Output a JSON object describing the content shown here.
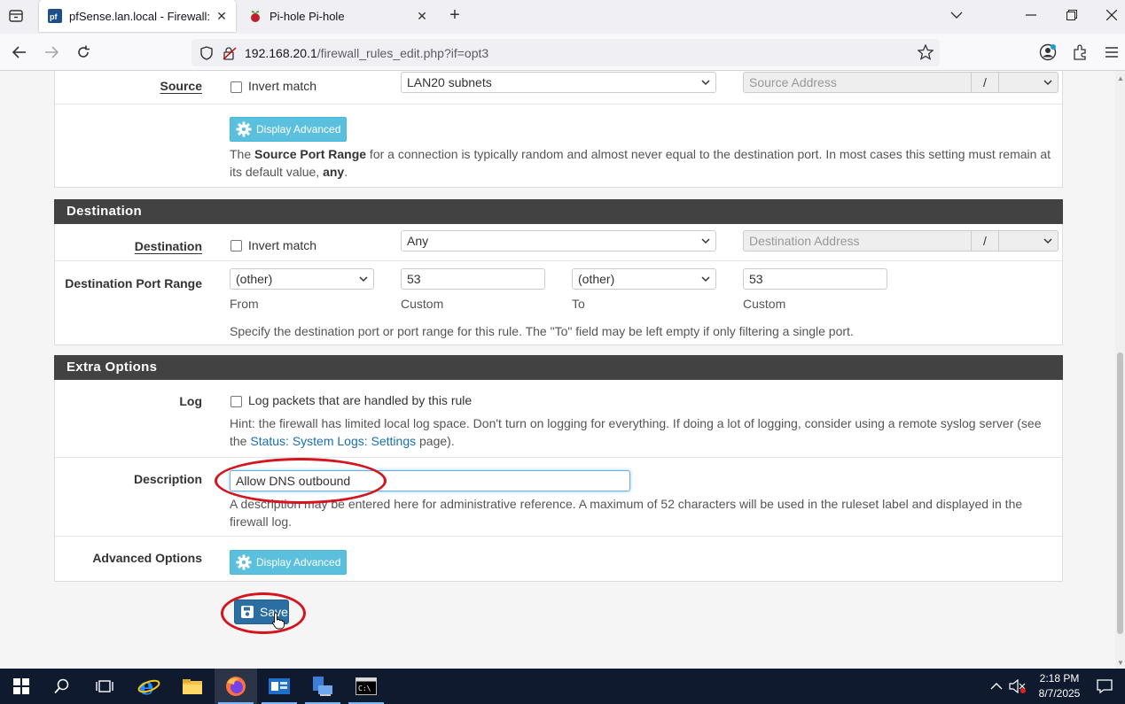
{
  "browser": {
    "tabs": [
      {
        "title": "pfSense.lan.local - Firewall: Rule",
        "active": true
      },
      {
        "title": "Pi-hole Pi-hole",
        "active": false
      }
    ],
    "url_host": "192.168.20.1",
    "url_path": "/firewall_rules_edit.php?if=opt3"
  },
  "source": {
    "label": "Source",
    "invert_label": "Invert match",
    "type_value": "LAN20 subnets",
    "address_placeholder": "Source Address",
    "slash": "/",
    "display_advanced_label": "Display Advanced",
    "help_pre": "The ",
    "help_bold": "Source Port Range",
    "help_mid": " for a connection is typically random and almost never equal to the destination port. In most cases this setting must remain at its default value, ",
    "help_bold2": "any",
    "help_end": "."
  },
  "destination": {
    "heading": "Destination",
    "label": "Destination",
    "invert_label": "Invert match",
    "type_value": "Any",
    "address_placeholder": "Destination Address",
    "slash": "/",
    "port_range_label": "Destination Port Range",
    "from_value": "(other)",
    "from_custom": "53",
    "to_value": "(other)",
    "to_custom": "53",
    "from_caption": "From",
    "custom_caption": "Custom",
    "to_caption": "To",
    "custom_caption2": "Custom",
    "help": "Specify the destination port or port range for this rule. The \"To\" field may be left empty if only filtering a single port."
  },
  "extra": {
    "heading": "Extra Options",
    "log_label": "Log",
    "log_checkbox_label": "Log packets that are handled by this rule",
    "log_hint_pre": "Hint: the firewall has limited local log space. Don't turn on logging for everything. If doing a lot of logging, consider using a remote syslog server (see the ",
    "log_hint_link": "Status: System Logs: Settings",
    "log_hint_post": " page).",
    "description_label": "Description",
    "description_value": "Allow DNS outbound",
    "description_help": "A description may be entered here for administrative reference. A maximum of 52 characters will be used in the ruleset label and displayed in the firewall log.",
    "advanced_label": "Advanced Options",
    "display_advanced_label": "Display Advanced"
  },
  "save_label": "Save",
  "taskbar": {
    "time": "2:18 PM",
    "date": "8/7/2025"
  },
  "colors": {
    "panel_heading": "#424242",
    "btn_info": "#5bc0de",
    "btn_primary": "#2b6ea1",
    "annotation": "#d4141e"
  }
}
